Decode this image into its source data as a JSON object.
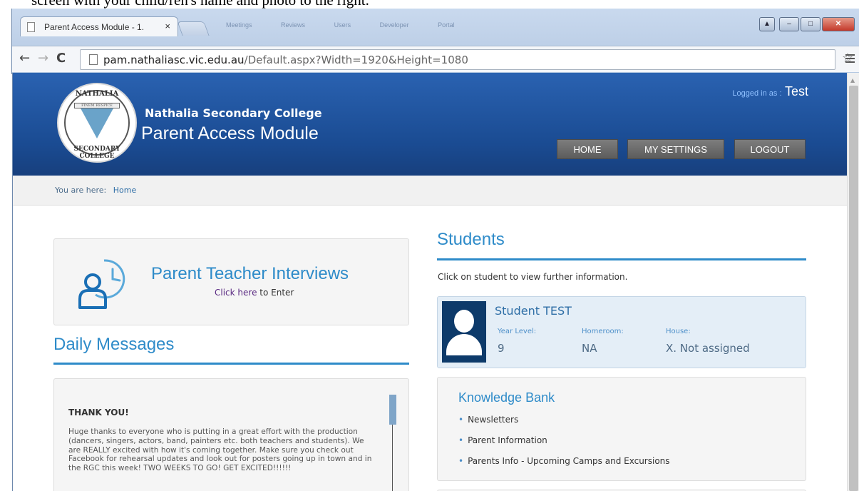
{
  "document_caption": "screen with your child/ren's name and photo to the right.",
  "browser": {
    "tab_title": "Parent Access Module - 1.",
    "tab_close": "×",
    "background_tabs": [
      "Meetings",
      "Reviews",
      "Users",
      "Developer",
      "Portal"
    ],
    "window_controls": {
      "minimize": "–",
      "maximize": "□",
      "close": "✕"
    },
    "nav": {
      "back": "←",
      "forward": "→",
      "reload": "C"
    },
    "url_host": "pam.nathaliasc.vic.edu.au",
    "url_path": "/Default.aspx?Width=1920&Height=1080",
    "star": "☆"
  },
  "header": {
    "logo_top": "NATHALIA",
    "logo_bottom": "SECONDARY COLLEGE",
    "logo_motto": "FINEM RESPICE",
    "school_name": "Nathalia Secondary College",
    "module_name": "Parent Access Module",
    "logged_in_label": "Logged in as :",
    "logged_in_user": "Test",
    "nav": {
      "home": "HOME",
      "settings": "MY SETTINGS",
      "logout": "LOGOUT"
    }
  },
  "breadcrumb": {
    "label": "You are here:",
    "current": "Home"
  },
  "pti": {
    "title": "Parent Teacher Interviews",
    "sub_link": "Click here",
    "sub_rest": " to Enter"
  },
  "daily_messages": {
    "title": "Daily Messages",
    "items": [
      {
        "heading": "THANK YOU!",
        "body": "Huge thanks to everyone who is putting in a great effort with the production (dancers, singers, actors, band, painters etc. both teachers and students). We are REALLY excited with how it's coming together. Make sure you check out Facebook for rehearsal updates and look out for posters going up in town and in the RGC this week! TWO WEEKS TO GO! GET EXCITED!!!!!!"
      }
    ]
  },
  "students": {
    "title": "Students",
    "hint": "Click on student to view further information.",
    "list": [
      {
        "name": "Student TEST",
        "year_level_label": "Year Level:",
        "year_level": "9",
        "homeroom_label": "Homeroom:",
        "homeroom": "NA",
        "house_label": "House:",
        "house": "X. Not assigned"
      }
    ]
  },
  "knowledge_bank": {
    "title": "Knowledge Bank",
    "bullet": "•",
    "items": [
      "Newsletters",
      "Parent Information",
      "Parents Info - Upcoming Camps and Excursions"
    ]
  }
}
